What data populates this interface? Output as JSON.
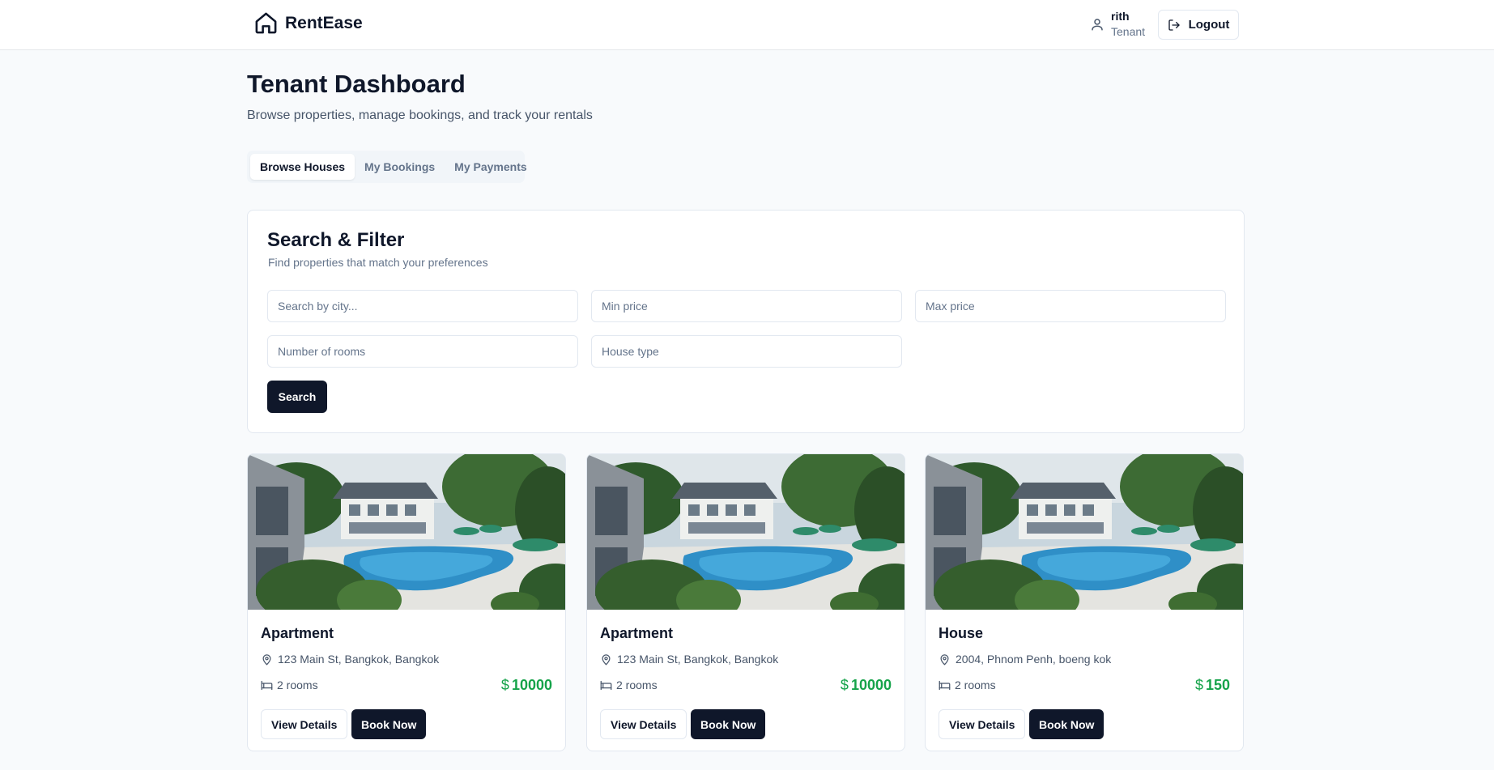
{
  "header": {
    "brand": "RentEase",
    "brand_icon": "home-icon",
    "user_name": "rith",
    "user_role": "Tenant",
    "user_icon": "user-icon",
    "logout_label": "Logout",
    "logout_icon": "logout-icon"
  },
  "page": {
    "title": "Tenant Dashboard",
    "subtitle": "Browse properties, manage bookings, and track your rentals"
  },
  "tabs": [
    {
      "label": "Browse Houses",
      "active": true
    },
    {
      "label": "My Bookings",
      "active": false
    },
    {
      "label": "My Payments",
      "active": false
    }
  ],
  "filter": {
    "title": "Search & Filter",
    "subtitle": "Find properties that match your preferences",
    "city_placeholder": "Search by city...",
    "min_price_placeholder": "Min price",
    "max_price_placeholder": "Max price",
    "rooms_placeholder": "Number of rooms",
    "type_placeholder": "House type",
    "search_label": "Search"
  },
  "listings": [
    {
      "title": "Apartment",
      "location": "123 Main St, Bangkok, Bangkok",
      "rooms": "2 rooms",
      "currency": "$",
      "price": "10000",
      "view_label": "View Details",
      "book_label": "Book Now"
    },
    {
      "title": "Apartment",
      "location": "123 Main St, Bangkok, Bangkok",
      "rooms": "2 rooms",
      "currency": "$",
      "price": "10000",
      "view_label": "View Details",
      "book_label": "Book Now"
    },
    {
      "title": "House",
      "location": "2004, Phnom Penh, boeng kok",
      "rooms": "2 rooms",
      "currency": "$",
      "price": "150",
      "view_label": "View Details",
      "book_label": "Book Now"
    }
  ],
  "colors": {
    "primary": "#0f172a",
    "price": "#16a34a",
    "muted": "#64748b",
    "background": "#f8fafc"
  }
}
